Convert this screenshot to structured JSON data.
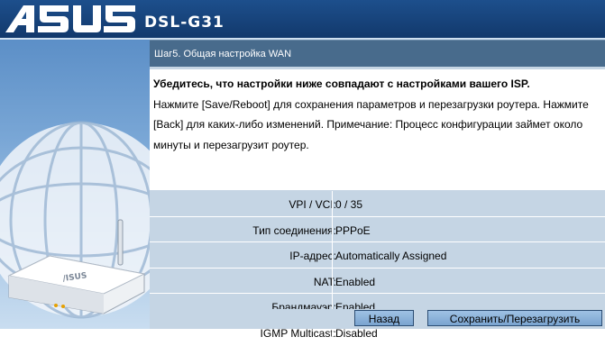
{
  "header": {
    "brand": "ASUS",
    "model": "DSL-G31"
  },
  "step": {
    "title": "Шаг5. Общая настройка WAN"
  },
  "notice": {
    "headline": "Убедитесь, что настройки ниже совпадают с настройками вашего ISP.",
    "body": "Нажмите [Save/Reboot] для сохранения параметров и перезагрузки роутера. Нажмите [Back] для каких-либо изменений. Примечание: Процесс конфигурации займет около минуты и перезагрузит роутер."
  },
  "settings": [
    {
      "label": "VPI / VCI:",
      "value": "0 / 35"
    },
    {
      "label": "Тип соединения:",
      "value": "PPPoE"
    },
    {
      "label": "IP-адрес:",
      "value": "Automatically Assigned"
    },
    {
      "label": "NAT:",
      "value": "Enabled"
    },
    {
      "label": "Брандмауэр:",
      "value": "Enabled"
    },
    {
      "label": "IGMP Multicast:",
      "value": "Disabled"
    }
  ],
  "buttons": {
    "back": "Назад",
    "save": "Сохранить/Перезагрузить"
  },
  "colors": {
    "header": "#1d4f8c",
    "title_bar": "#486b8c",
    "content_bg": "#c5d5e4",
    "button": "#8fb5dc"
  }
}
